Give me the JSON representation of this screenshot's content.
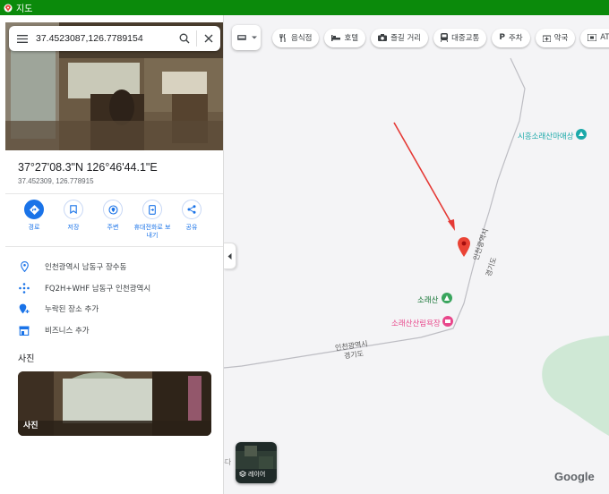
{
  "window": {
    "title": "지도"
  },
  "search": {
    "query": "37.4523087,126.7789154"
  },
  "place": {
    "title": "37°27'08.3\"N 126°46'44.1\"E",
    "subtitle": "37.452309, 126.778915"
  },
  "actions": [
    {
      "label": "경로",
      "icon": "directions-icon"
    },
    {
      "label": "저장",
      "icon": "bookmark-icon"
    },
    {
      "label": "주변",
      "icon": "nearby-icon"
    },
    {
      "label": "휴대전화로 보내기",
      "icon": "phone-icon"
    },
    {
      "label": "공유",
      "icon": "share-icon"
    }
  ],
  "info": [
    {
      "text": "인천광역시 남동구 장수동",
      "icon": "location-pin-icon"
    },
    {
      "text": "FQ2H+WHF 남동구 인천광역시",
      "icon": "plus-code-icon"
    },
    {
      "text": "누락된 장소 추가",
      "icon": "add-place-icon"
    },
    {
      "text": "비즈니스 추가",
      "icon": "store-icon"
    }
  ],
  "photos": {
    "heading": "사진",
    "caption": "사진"
  },
  "chips": [
    {
      "label": "음식점",
      "icon": "fork-knife-icon"
    },
    {
      "label": "호텔",
      "icon": "bed-icon"
    },
    {
      "label": "즐길 거리",
      "icon": "camera-icon"
    },
    {
      "label": "대중교통",
      "icon": "train-icon"
    },
    {
      "label": "주차",
      "icon": "parking-icon"
    },
    {
      "label": "약국",
      "icon": "pharmacy-icon"
    },
    {
      "label": "ATM",
      "icon": "atm-icon"
    }
  ],
  "map": {
    "labels": {
      "poi_mountain_yard": "시흥소래산마애상",
      "border_ic1": "인천광역시",
      "border_gg1": "경기도",
      "mountain": "소래산",
      "forest_yard": "소래산산림욕장",
      "border_ic2": "인천광역시",
      "border_gg2": "경기도",
      "partial": "-다"
    },
    "layer_label": "레이어",
    "logo": "Google"
  },
  "colors": {
    "accent": "#1a73e8",
    "pin": "#ea4335",
    "titlebar": "#0b8a0b",
    "park": "#3aa55e",
    "poi_pink": "#e8478b",
    "poi_teal": "#1ba9a9"
  }
}
